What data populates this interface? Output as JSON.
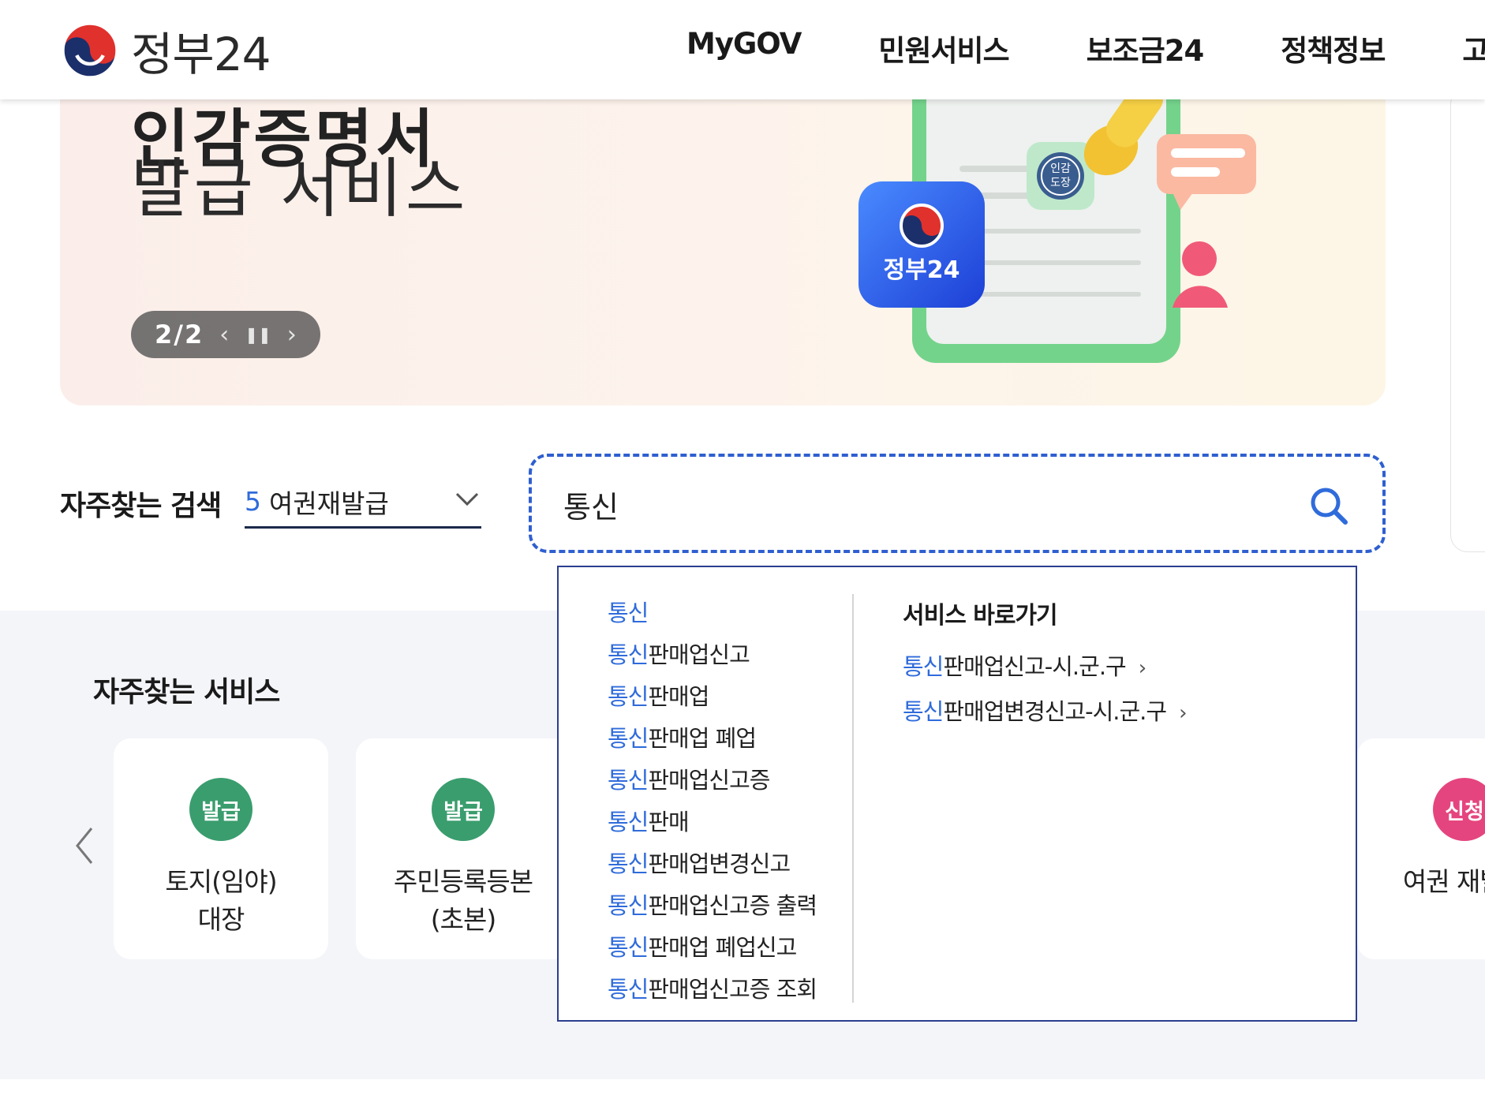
{
  "header": {
    "logo_text": "정부24",
    "nav": [
      "MyGOV",
      "민원서비스",
      "보조금24",
      "정책정보",
      "고객"
    ]
  },
  "banner": {
    "title_line1": "인감증명서",
    "title_line2": "발급 서비스",
    "slide_counter": "2/2",
    "prev_icon": "chevron-left",
    "pause_icon": "pause",
    "next_icon": "chevron-right",
    "app_icon_label": "정부24",
    "stamp_text": "인감도장"
  },
  "frequent_search": {
    "label": "자주찾는 검색",
    "rank": "5",
    "keyword": "여권재발급"
  },
  "search": {
    "value": "통신",
    "icon": "search-icon"
  },
  "autocomplete": {
    "suggestions": [
      {
        "highlight": "통신",
        "rest": ""
      },
      {
        "highlight": "통신",
        "rest": "판매업신고"
      },
      {
        "highlight": "통신",
        "rest": "판매업"
      },
      {
        "highlight": "통신",
        "rest": "판매업 폐업"
      },
      {
        "highlight": "통신",
        "rest": "판매업신고증"
      },
      {
        "highlight": "통신",
        "rest": "판매"
      },
      {
        "highlight": "통신",
        "rest": "판매업변경신고"
      },
      {
        "highlight": "통신",
        "rest": "판매업신고증 출력"
      },
      {
        "highlight": "통신",
        "rest": "판매업 폐업신고"
      },
      {
        "highlight": "통신",
        "rest": "판매업신고증 조회"
      }
    ],
    "shortcut_title": "서비스 바로가기",
    "shortcuts": [
      {
        "highlight": "통신",
        "rest": "판매업신고-시.군.구",
        "arrow": "›"
      },
      {
        "highlight": "통신",
        "rest": "판매업변경신고-시.군.구",
        "arrow": "›"
      }
    ]
  },
  "frequent_services": {
    "title": "자주찾는 서비스",
    "cards": [
      {
        "badge": "발급",
        "badge_color": "#3a9d6e",
        "line1": "토지(임야)",
        "line2": "대장"
      },
      {
        "badge": "발급",
        "badge_color": "#3a9d6e",
        "line1": "주민등록등본",
        "line2": "(초본)"
      },
      {
        "badge": "신청",
        "badge_color": "#e5457e",
        "line1": "여권 재발급",
        "line2": ""
      }
    ]
  },
  "colors": {
    "accent_blue": "#2f6bdb",
    "dropdown_border": "#2b3f8f",
    "badge_green": "#3a9d6e",
    "badge_pink": "#e5457e"
  }
}
